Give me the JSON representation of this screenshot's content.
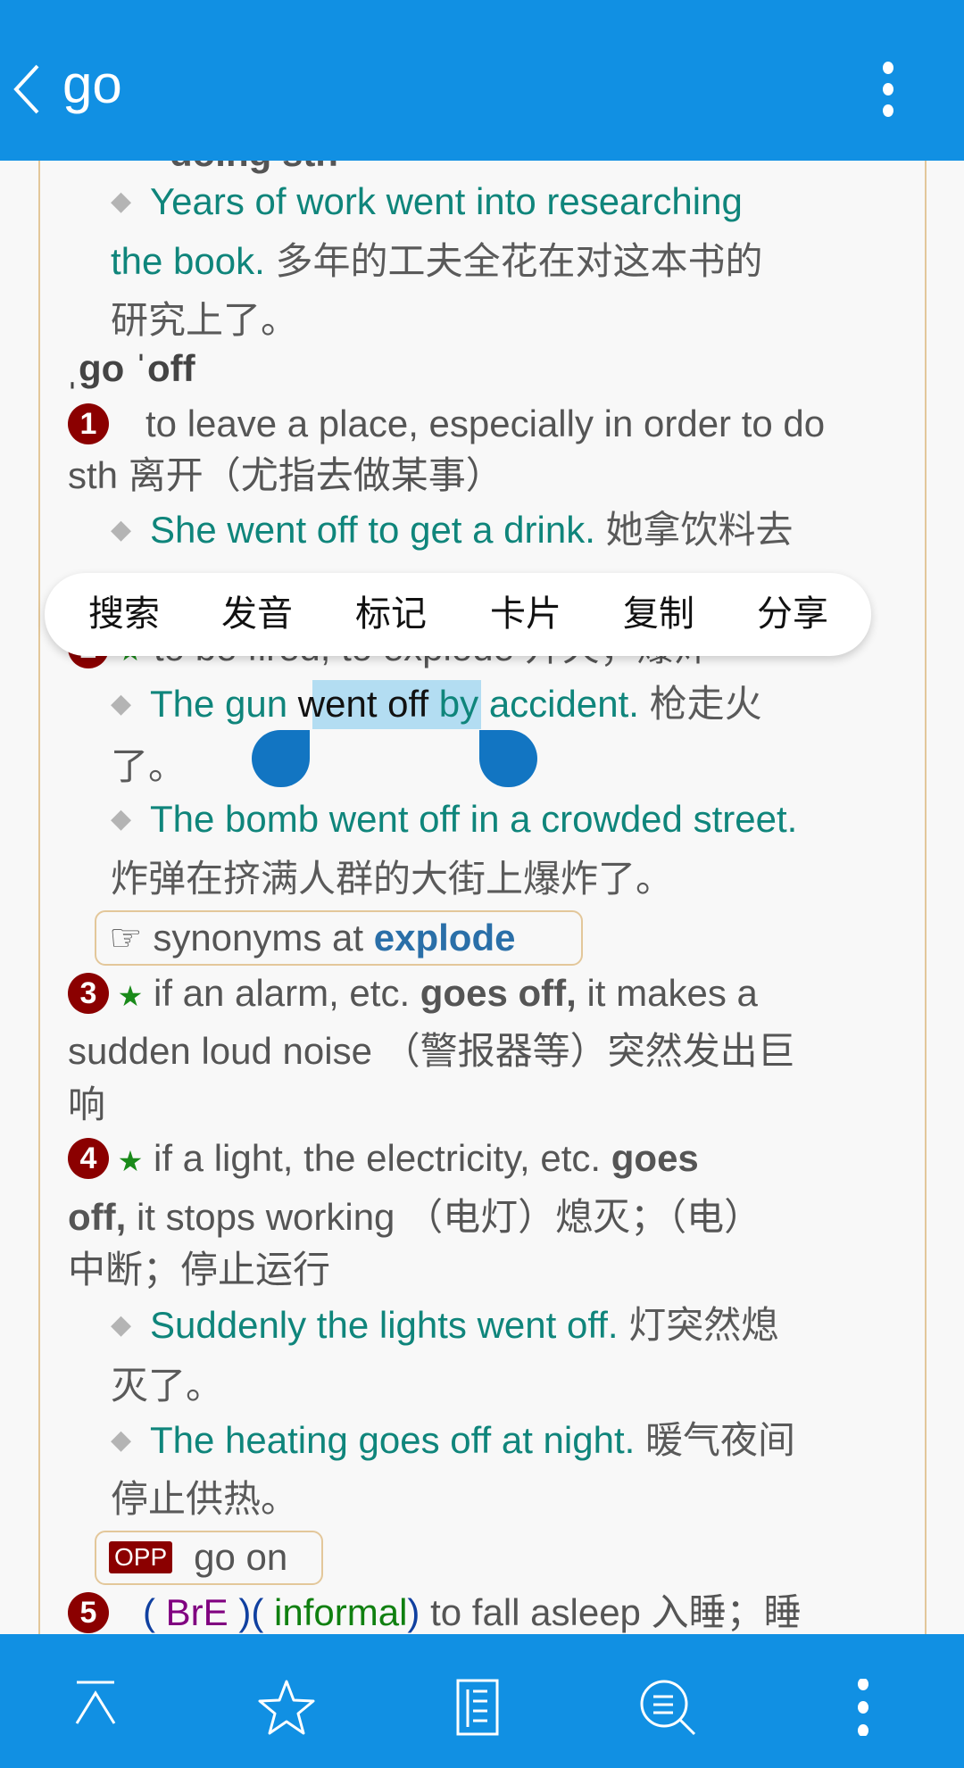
{
  "header": {
    "title": "go",
    "back_icon": "chevron-left-icon",
    "more_icon": "more-vert-icon",
    "color": "#1190e3"
  },
  "entry": {
    "clipped_top": "doing sth",
    "ex0": {
      "en1": "Years of work went into researching",
      "en2": "the book.",
      "zh1": "多年的工夫全花在对这本书的",
      "zh2": "研究上了。"
    },
    "phrase": "ˌgo ˈoff",
    "sense1": {
      "num": "1",
      "def1": "to leave a place, especially in order to do",
      "def2": "sth",
      "zh": "离开（尤指去做某事）",
      "ex": {
        "en": "She went off to get a drink.",
        "zh": "她拿饮料去"
      }
    },
    "sense2": {
      "num": "2",
      "def": "to be fired, to explode 开火；爆炸",
      "ex1": {
        "en_a": "The gun",
        "en_sel": "went off",
        "en_b": "by accident.",
        "zh1": "枪走火",
        "zh2": "了。"
      },
      "ex2": {
        "en": "The bomb went off in a crowded street.",
        "zh": "炸弹在挤满人群的大街上爆炸了。"
      },
      "syn": {
        "icon": "☞",
        "text": "synonyms at",
        "link": "explode"
      }
    },
    "sense3": {
      "num": "3",
      "def_a": "if an alarm, etc.",
      "def_b": "goes off,",
      "def_c": "it makes a",
      "line2": "sudden loud noise （警报器等）突然发出巨",
      "line3": "响"
    },
    "sense4": {
      "num": "4",
      "def_a": "if a light, the electricity, etc.",
      "def_b": "goes",
      "line2_b": "off,",
      "line2_c": "it stops working （电灯）熄灭；（电）",
      "line3": "中断；停止运行",
      "ex1": {
        "en": "Suddenly the lights went off.",
        "zh1": "灯突然熄",
        "zh2": "灭了。"
      },
      "ex2": {
        "en": "The heating goes off at night.",
        "zh1": "暖气夜间",
        "zh2": "停止供热。"
      },
      "opp": {
        "label": "OPP",
        "text": "go on"
      }
    },
    "sense5": {
      "num": "5",
      "reg1": "BrE",
      "reg2": "informal",
      "def": "to fall asleep 入睡；睡"
    }
  },
  "popup": {
    "items": [
      "搜索",
      "发音",
      "标记",
      "卡片",
      "复制",
      "分享"
    ]
  },
  "bottom_bar": {
    "icons": [
      "scroll-top-icon",
      "star-icon",
      "document-list-icon",
      "search-list-icon",
      "more-vert-icon"
    ]
  }
}
